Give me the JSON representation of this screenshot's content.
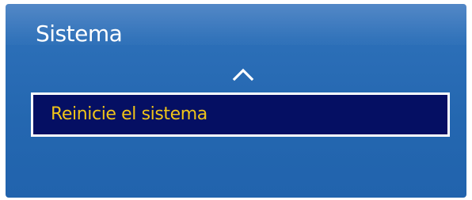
{
  "panel": {
    "title": "Sistema",
    "scroll_up_icon": "chevron-up-icon",
    "items": [
      {
        "label": "Reinicie el sistema",
        "selected": true
      }
    ]
  },
  "colors": {
    "panel_blue": "#2467b0",
    "selected_bg": "#050f63",
    "selected_text": "#f0c419",
    "selected_border": "#ffffff",
    "title_text": "#ffffff"
  }
}
